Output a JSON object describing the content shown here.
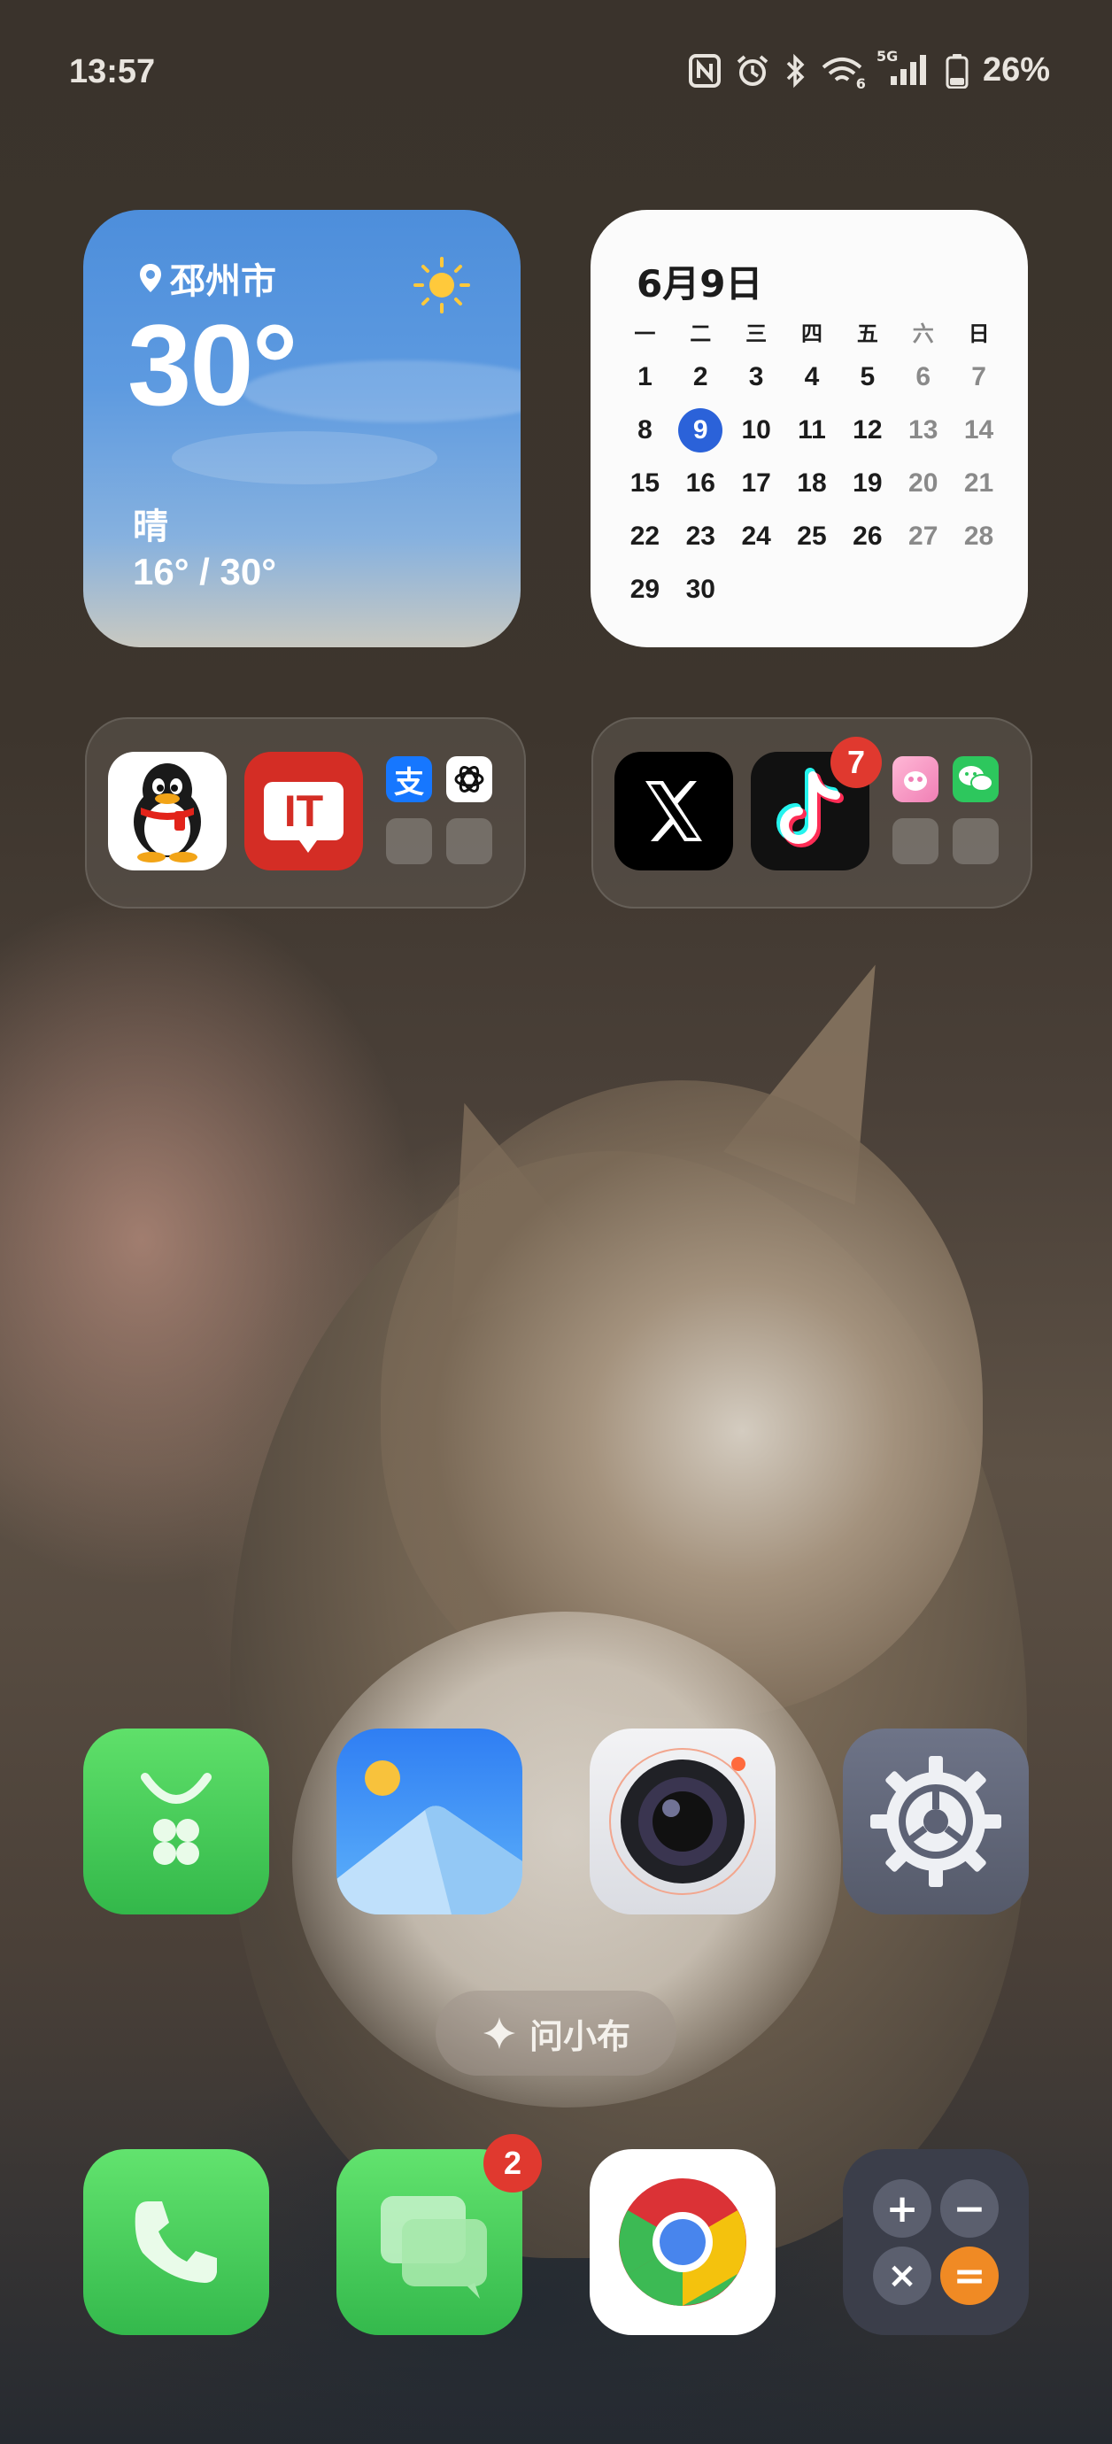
{
  "status_bar": {
    "time": "13:57",
    "network_label": "5G",
    "wifi_label": "6",
    "battery": "26%"
  },
  "weather": {
    "location": "邳州市",
    "temperature": "30°",
    "condition": "晴",
    "range": "16° / 30°"
  },
  "calendar": {
    "title": "6月9日",
    "weekdays": [
      "一",
      "二",
      "三",
      "四",
      "五",
      "六",
      "日"
    ],
    "rows": [
      [
        "1",
        "2",
        "3",
        "4",
        "5",
        "6",
        "7"
      ],
      [
        "8",
        "9",
        "10",
        "11",
        "12",
        "13",
        "14"
      ],
      [
        "15",
        "16",
        "17",
        "18",
        "19",
        "20",
        "21"
      ],
      [
        "22",
        "23",
        "24",
        "25",
        "26",
        "27",
        "28"
      ],
      [
        "29",
        "30",
        "",
        "",
        "",
        "",
        ""
      ]
    ],
    "today": "9"
  },
  "folder1": {
    "apps": [
      "QQ",
      "IT之家"
    ],
    "mini_apps": [
      "支付宝",
      "ChatGPT"
    ],
    "it_label": "IT",
    "alipay_glyph": "支"
  },
  "folder2": {
    "apps": [
      "X",
      "抖音"
    ],
    "tiktok_badge": "7",
    "mini_apps": [
      "小红书",
      "微信"
    ]
  },
  "assistant": {
    "label": "问小布"
  },
  "messages_badge": "2",
  "calculator_keys": [
    "+",
    "−",
    "×",
    "="
  ]
}
